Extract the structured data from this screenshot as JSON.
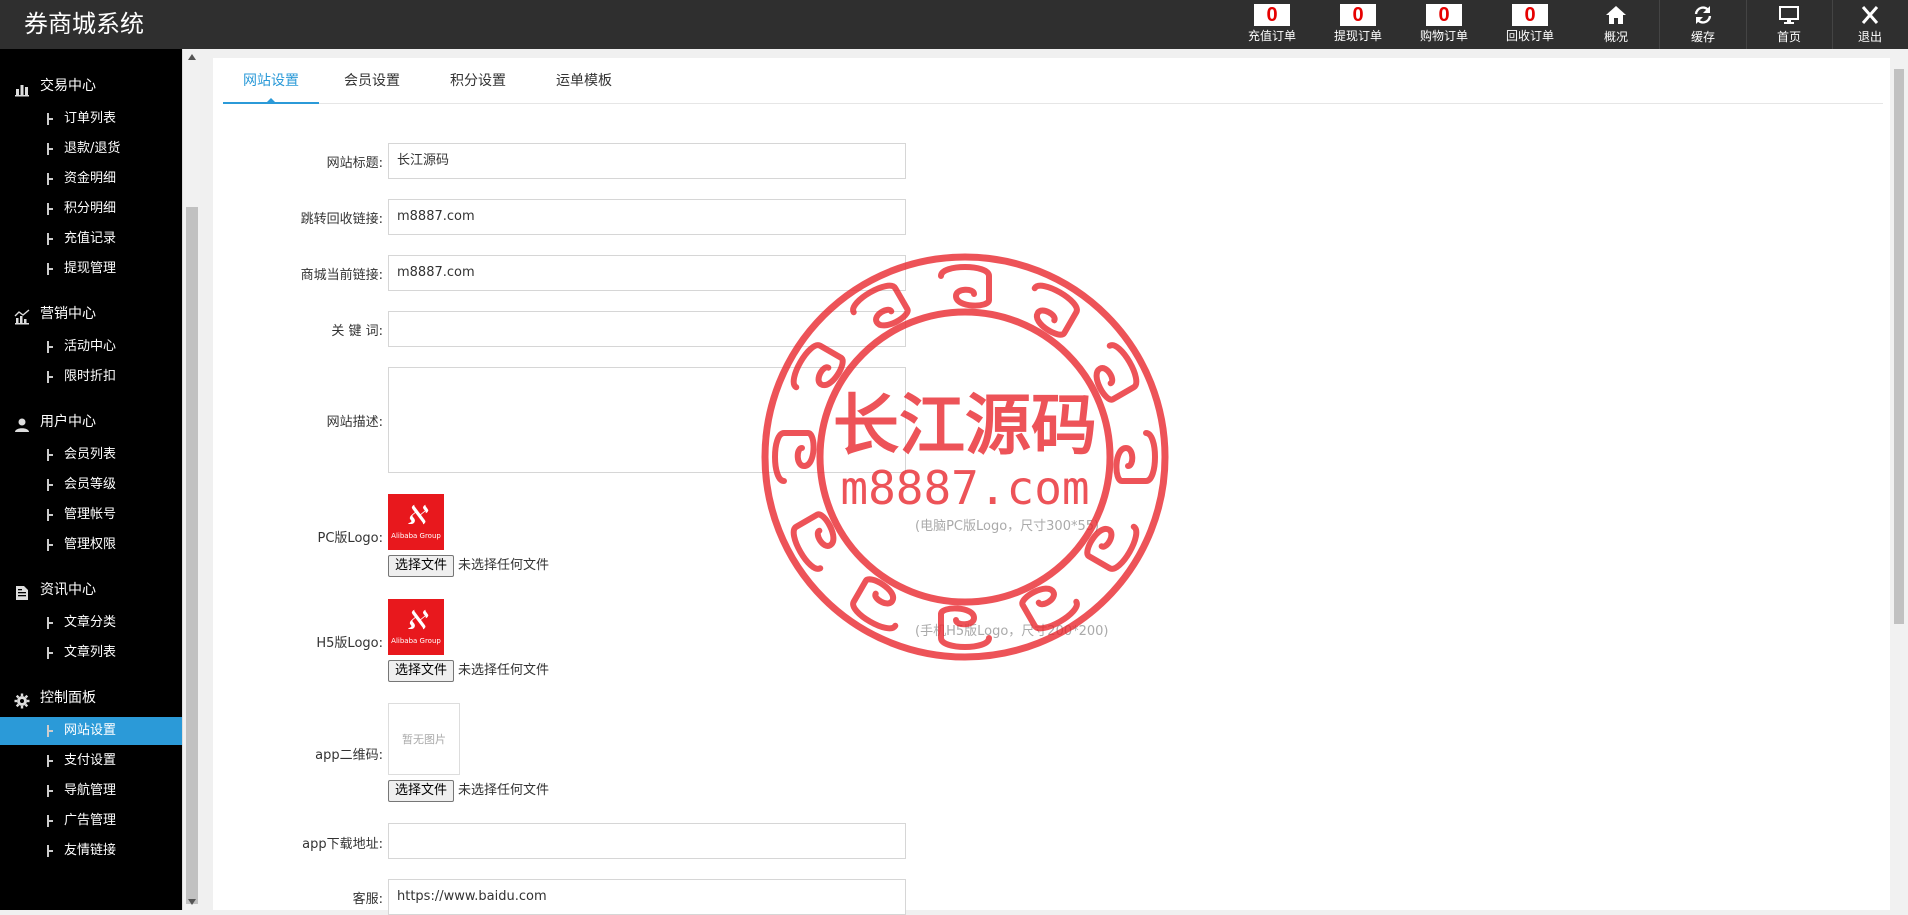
{
  "app": {
    "title": "券商城系统"
  },
  "topnav": {
    "counters": [
      {
        "count": "0",
        "label": "充值订单"
      },
      {
        "count": "0",
        "label": "提现订单"
      },
      {
        "count": "0",
        "label": "购物订单"
      },
      {
        "count": "0",
        "label": "回收订单"
      }
    ],
    "actions": [
      {
        "icon": "home-icon",
        "label": "概况"
      },
      {
        "icon": "refresh-icon",
        "label": "缓存"
      },
      {
        "icon": "monitor-icon",
        "label": "首页"
      },
      {
        "icon": "close-icon",
        "label": "退出"
      }
    ]
  },
  "sidebar": {
    "groups": [
      {
        "title": "交易中心",
        "icon": "bar-chart-icon",
        "items": [
          "订单列表",
          "退款/退货",
          "资金明细",
          "积分明细",
          "充值记录",
          "提现管理"
        ]
      },
      {
        "title": "营销中心",
        "icon": "trend-chart-icon",
        "items": [
          "活动中心",
          "限时折扣"
        ]
      },
      {
        "title": "用户中心",
        "icon": "user-icon",
        "items": [
          "会员列表",
          "会员等级",
          "管理帐号",
          "管理权限"
        ]
      },
      {
        "title": "资讯中心",
        "icon": "document-icon",
        "items": [
          "文章分类",
          "文章列表"
        ]
      },
      {
        "title": "控制面板",
        "icon": "gear-icon",
        "items": [
          "网站设置",
          "支付设置",
          "导航管理",
          "广告管理",
          "友情链接"
        ]
      }
    ],
    "active_item": "网站设置"
  },
  "tabs": [
    "网站设置",
    "会员设置",
    "积分设置",
    "运单模板"
  ],
  "active_tab": "网站设置",
  "form": {
    "site_title": {
      "label": "网站标题:",
      "value": "长江源码"
    },
    "redirect_link": {
      "label": "跳转回收链接:",
      "value": "m8887.com"
    },
    "mall_link": {
      "label": "商城当前链接:",
      "value": "m8887.com"
    },
    "keywords": {
      "label": "关 键 词:",
      "value": ""
    },
    "description": {
      "label": "网站描述:",
      "value": ""
    },
    "pc_logo": {
      "label": "PC版Logo:",
      "hint": "(电脑PC版Logo，尺寸300*55)",
      "logo_brand": "Alibaba Group"
    },
    "h5_logo": {
      "label": "H5版Logo:",
      "hint": "(手机H5版Logo，尺寸200*200)",
      "logo_brand": "Alibaba Group"
    },
    "app_qrcode": {
      "label": "app二维码:",
      "placeholder_text": "暂无图片"
    },
    "app_download": {
      "label": "app下载地址:",
      "value": ""
    },
    "customer_service": {
      "label": "客服:",
      "value": "https://www.baidu.com"
    },
    "file_button": "选择文件",
    "file_status": "未选择任何文件"
  },
  "watermark": {
    "line1": "长江源码",
    "line2": "m8887.com",
    "color": "#e8232a"
  }
}
